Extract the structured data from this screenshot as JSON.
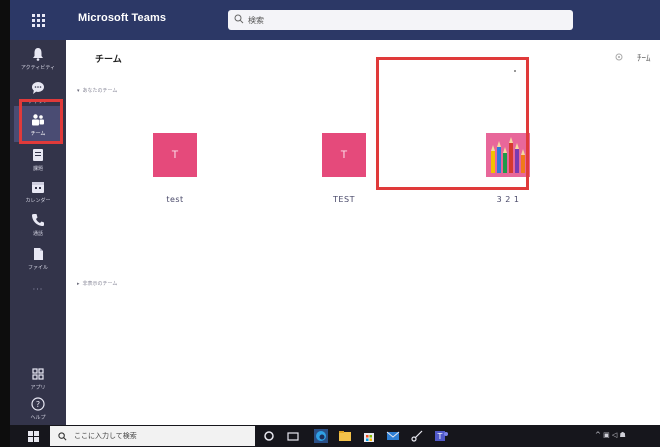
{
  "header": {
    "app_title": "Microsoft Teams",
    "search_placeholder": "検索"
  },
  "rail": {
    "items": [
      {
        "label": "アクティビティ",
        "icon": "bell-icon"
      },
      {
        "label": "チャット",
        "icon": "chat-icon"
      },
      {
        "label": "チーム",
        "icon": "teams-icon",
        "active": true
      },
      {
        "label": "課題",
        "icon": "assignments-icon"
      },
      {
        "label": "カレンダー",
        "icon": "calendar-icon"
      },
      {
        "label": "通話",
        "icon": "phone-icon"
      },
      {
        "label": "ファイル",
        "icon": "files-icon"
      }
    ],
    "more": "···",
    "apps_label": "アプリ",
    "help_label": "ヘルプ"
  },
  "page": {
    "title": "チーム",
    "header_right_icon": "gear-icon",
    "header_right_text": "ﾁｰﾑ"
  },
  "sections": [
    {
      "label": "あなたのチーム"
    },
    {
      "label": "非表示のチーム"
    }
  ],
  "teams": [
    {
      "name": "test",
      "initial": "T",
      "color": "#e54a7b"
    },
    {
      "name": "TEST",
      "initial": "T",
      "color": "#e54a7b"
    },
    {
      "name": "3 2 1",
      "image": "colored-pencils",
      "color": "#e8679a"
    }
  ],
  "taskbar": {
    "search_placeholder": "ここに入力して検索",
    "tray": "^ ▣ ◁ ☗"
  },
  "colors": {
    "header": "#2c3866",
    "rail": "#33344a",
    "team_tile": "#e54a7b",
    "highlight": "#e03a3a"
  }
}
